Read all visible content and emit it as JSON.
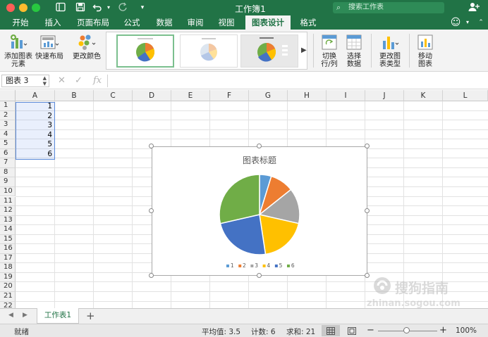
{
  "window": {
    "title": "工作簿1",
    "search_placeholder": "搜索工作表"
  },
  "tabs": [
    {
      "label": "开始"
    },
    {
      "label": "插入"
    },
    {
      "label": "页面布局"
    },
    {
      "label": "公式"
    },
    {
      "label": "数据"
    },
    {
      "label": "审阅"
    },
    {
      "label": "视图"
    },
    {
      "label": "图表设计"
    },
    {
      "label": "格式"
    }
  ],
  "ribbon": {
    "add_element_line1": "添加图表",
    "add_element_line2": "元素",
    "quick_layout": "快速布局",
    "change_colors": "更改颜色",
    "switch_row_col_line1": "切换",
    "switch_row_col_line2": "行/列",
    "select_data_line1": "选择",
    "select_data_line2": "数据",
    "change_type_line1": "更改图",
    "change_type_line2": "表类型",
    "move_chart_line1": "移动",
    "move_chart_line2": "图表"
  },
  "formula_bar": {
    "name_box": "图表 3",
    "fx": "fx"
  },
  "sheet": {
    "columns": [
      "A",
      "B",
      "C",
      "D",
      "E",
      "F",
      "G",
      "H",
      "I",
      "J",
      "K",
      "L"
    ],
    "rows": [
      "1",
      "2",
      "3",
      "4",
      "5",
      "6",
      "7",
      "8",
      "9",
      "10",
      "11",
      "12",
      "13",
      "14",
      "15",
      "16",
      "17",
      "18",
      "19",
      "20",
      "21",
      "22"
    ],
    "column_a_values": [
      "1",
      "2",
      "3",
      "4",
      "5",
      "6"
    ]
  },
  "chart_data": {
    "type": "pie",
    "title": "图表标题",
    "categories": [
      "1",
      "2",
      "3",
      "4",
      "5",
      "6"
    ],
    "values": [
      1,
      2,
      3,
      4,
      5,
      6
    ],
    "colors": [
      "#5b9bd5",
      "#ed7d31",
      "#a5a5a5",
      "#ffc000",
      "#4472c4",
      "#70ad47"
    ],
    "legend_position": "bottom"
  },
  "sheet_tabs": {
    "active": "工作表1",
    "add": "+"
  },
  "status": {
    "ready": "就绪",
    "average": "平均值: 3.5",
    "count": "计数: 6",
    "sum": "求和: 21",
    "zoom": "100%"
  },
  "watermark": {
    "brand": "搜狗指南",
    "url": "zhinan.sogou.com"
  }
}
